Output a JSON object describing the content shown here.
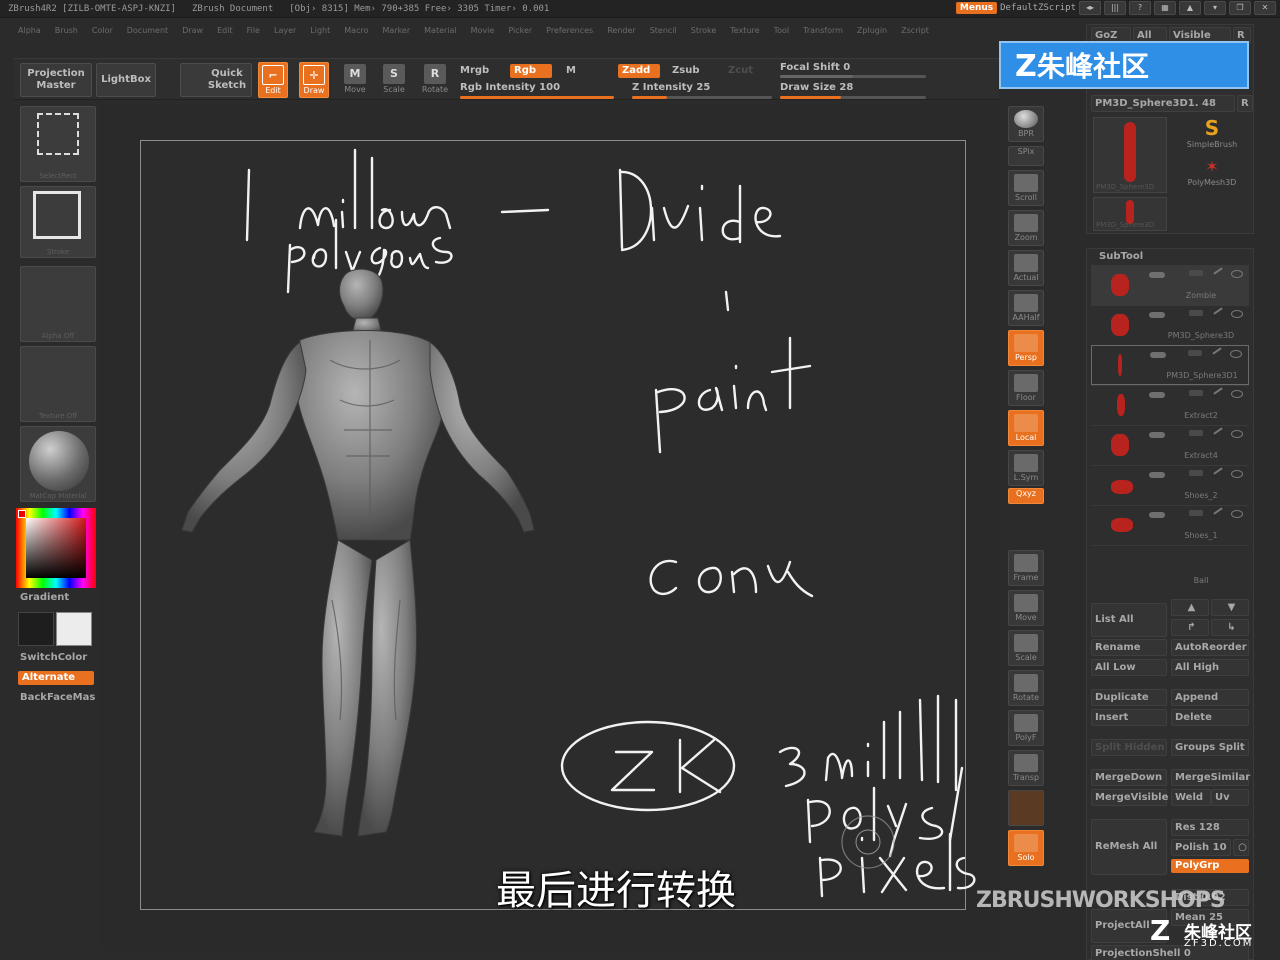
{
  "titlebar": {
    "app": "ZBrush4R2 [ZILB-OMTE-ASPJ-KNZI]",
    "document": "ZBrush Document",
    "stats": "[Obj› 8315] Mem› 790+385 Free› 3305 Timer› 0.001",
    "menus": "Menus",
    "script": "DefaultZScript"
  },
  "menu": [
    "Alpha",
    "Brush",
    "Color",
    "Document",
    "Draw",
    "Edit",
    "File",
    "Layer",
    "Light",
    "Macro",
    "Marker",
    "Material",
    "Movie",
    "Picker",
    "Preferences",
    "Render",
    "Stencil",
    "Stroke",
    "Texture",
    "Tool",
    "Transform",
    "Zplugin",
    "Zscript"
  ],
  "toolbar": {
    "projection_master": "Projection Master",
    "lightbox": "LightBox",
    "quick_sketch": "Quick Sketch",
    "edit": "Edit",
    "draw": "Draw",
    "move": "Move",
    "scale": "Scale",
    "rotate": "Rotate",
    "mrgb": "Mrgb",
    "rgb": "Rgb",
    "m": "M",
    "rgb_intensity": "Rgb Intensity 100",
    "zadd": "Zadd",
    "zsub": "Zsub",
    "zcut": "Zcut",
    "z_intensity": "Z Intensity 25",
    "focal_shift": "Focal Shift 0",
    "draw_size": "Draw Size 28",
    "rgb_intensity_value": 100,
    "z_intensity_value": 25,
    "draw_size_value": 28
  },
  "left": {
    "swatch1": "SelectRect",
    "swatch2": "Stroke",
    "swatch3": "Alpha Off",
    "swatch4": "Texture Off",
    "swatch5": "MatCap Material",
    "gradient": "Gradient",
    "switchcolor": "SwitchColor",
    "alternate": "Alternate",
    "backface": "BackFaceMas"
  },
  "canvas": {
    "notes": [
      "1 million polygons",
      "—",
      "Divide",
      "paint",
      "conv",
      "ZK",
      "3 mill polys/ pixels"
    ]
  },
  "rightstrip": [
    "BPR",
    "SPix",
    "Scroll",
    "Zoom",
    "Actual",
    "AAHalf",
    "Persp",
    "Floor",
    "Local",
    "L.Sym",
    "Qxyz",
    "Frame",
    "Move",
    "Scale",
    "Rotate",
    "PolyF",
    "Transp",
    "Solo"
  ],
  "toolpanel": {
    "goz": "GoZ",
    "all": "All",
    "visible": "Visible",
    "r": "R",
    "current": "PM3D_Sphere3D1. 48",
    "simplebrush": "SimpleBrush",
    "polymesh": "PolyMesh3D",
    "thumb1": "PM3D_Sphere3D",
    "thumb2": "PM3D_Sphere3D"
  },
  "subtool": {
    "title": "SubTool",
    "items": [
      "Zombie",
      "PM3D_Sphere3D",
      "PM3D_Sphere3D1",
      "Extract2",
      "Extract4",
      "Shoes_2",
      "Shoes_1",
      "Ball"
    ],
    "list_all": "List All",
    "rename": "Rename",
    "autoreorder": "AutoReorder",
    "all_low": "All Low",
    "all_high": "All High",
    "duplicate": "Duplicate",
    "append": "Append",
    "insert": "Insert",
    "delete": "Delete",
    "split_hidden": "Split Hidden",
    "groups_split": "Groups Split",
    "mergedown": "MergeDown",
    "mergesimilar": "MergeSimilar",
    "mergevisible": "MergeVisible",
    "weld": "Weld",
    "uv": "Uv",
    "remesh_all": "ReMesh All",
    "res": "Res 128",
    "polish": "Polish 10",
    "polygrp": "PolyGrp",
    "projectall": "ProjectAll",
    "dist": "Dist 0.02",
    "mean": "Mean 25",
    "projectionshell": "ProjectionShell 0"
  },
  "overlay": {
    "subtitle": "最后进行转换",
    "logo": "朱峰社区",
    "watermark": "ZBRUSHWORKSHOPS",
    "wm_cn": "朱峰社区",
    "wm_url": "ZF3D.COM"
  },
  "colors": {
    "accent": "#e8701e",
    "background": "#2b2b2b",
    "logo_blue": "#2f8ee6"
  }
}
